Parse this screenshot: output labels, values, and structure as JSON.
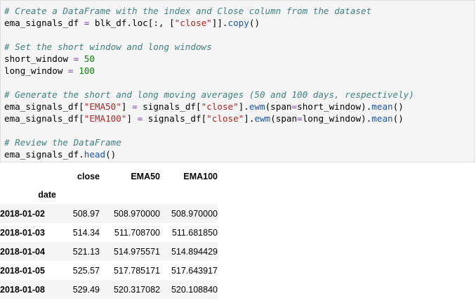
{
  "code": {
    "l1": "# Create a DataFrame with the index and Close column from the dataset",
    "l2": [
      "ema_signals_df ",
      "=",
      " blk_df",
      ".",
      "loc",
      "[:, [",
      "\"close\"",
      "]]",
      ".",
      "copy",
      "()"
    ],
    "l4": "# Set the short window and long windows",
    "l5": [
      "short_window ",
      "=",
      " ",
      "50"
    ],
    "l6": [
      "long_window ",
      "=",
      " ",
      "100"
    ],
    "l8": "# Generate the short and long moving averages (50 and 100 days, respectively)",
    "l9": [
      "ema_signals_df[",
      "\"EMA50\"",
      "] ",
      "=",
      " signals_df[",
      "\"close\"",
      "]",
      ".",
      "ewm",
      "(span",
      "=",
      "short_window)",
      ".",
      "mean",
      "()"
    ],
    "l10": [
      "ema_signals_df[",
      "\"EMA100\"",
      "] ",
      "=",
      " signals_df[",
      "\"close\"",
      "]",
      ".",
      "ewm",
      "(span",
      "=",
      "long_window)",
      ".",
      "mean",
      "()"
    ],
    "l12": "# Review the DataFrame",
    "l13": [
      "ema_signals_df",
      ".",
      "head",
      "()"
    ]
  },
  "table": {
    "columns": [
      "close",
      "EMA50",
      "EMA100"
    ],
    "index_name": "date",
    "rows": [
      {
        "date": "2018-01-02",
        "close": "508.97",
        "ema50": "508.970000",
        "ema100": "508.970000"
      },
      {
        "date": "2018-01-03",
        "close": "514.34",
        "ema50": "511.708700",
        "ema100": "511.681850"
      },
      {
        "date": "2018-01-04",
        "close": "521.13",
        "ema50": "514.975571",
        "ema100": "514.894429"
      },
      {
        "date": "2018-01-05",
        "close": "525.57",
        "ema50": "517.785171",
        "ema100": "517.643917"
      },
      {
        "date": "2018-01-08",
        "close": "529.49",
        "ema50": "520.317082",
        "ema100": "520.108840"
      }
    ]
  }
}
